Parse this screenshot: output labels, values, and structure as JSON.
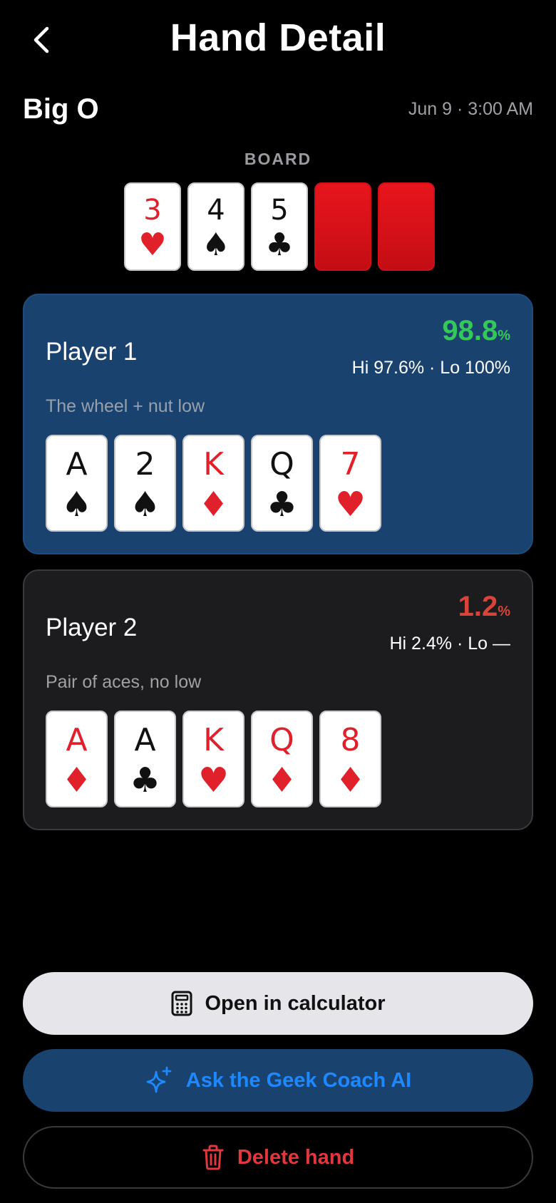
{
  "header": {
    "title": "Hand Detail",
    "back_icon": "chevron-left-icon"
  },
  "hand_info": {
    "game": "Big O",
    "datetime": "Jun 9 · 3:00 AM"
  },
  "board": {
    "label": "BOARD",
    "cards": [
      {
        "rank": "3",
        "suit": "♥",
        "color": "red"
      },
      {
        "rank": "4",
        "suit": "♠",
        "color": "black"
      },
      {
        "rank": "5",
        "suit": "♣",
        "color": "black"
      },
      {
        "face_down": true
      },
      {
        "face_down": true
      }
    ]
  },
  "players": [
    {
      "name": "Player 1",
      "equity": "98.8",
      "equity_unit": "%",
      "hilo": "Hi 97.6% · Lo 100%",
      "description": "The wheel + nut low",
      "accent": "#35c759",
      "cards": [
        {
          "rank": "A",
          "suit": "♠",
          "color": "black"
        },
        {
          "rank": "2",
          "suit": "♠",
          "color": "black"
        },
        {
          "rank": "K",
          "suit": "♦",
          "color": "red"
        },
        {
          "rank": "Q",
          "suit": "♣",
          "color": "black"
        },
        {
          "rank": "7",
          "suit": "♥",
          "color": "red"
        }
      ]
    },
    {
      "name": "Player 2",
      "equity": "1.2",
      "equity_unit": "%",
      "hilo": "Hi 2.4% · Lo —",
      "description": "Pair of aces, no low",
      "accent": "#d8433a",
      "cards": [
        {
          "rank": "A",
          "suit": "♦",
          "color": "red"
        },
        {
          "rank": "A",
          "suit": "♣",
          "color": "black"
        },
        {
          "rank": "K",
          "suit": "♥",
          "color": "red"
        },
        {
          "rank": "Q",
          "suit": "♦",
          "color": "red"
        },
        {
          "rank": "8",
          "suit": "♦",
          "color": "red"
        }
      ]
    }
  ],
  "actions": {
    "calculator_label": "Open in calculator",
    "calculator_icon": "calculator-icon",
    "coach_label": "Ask the Geek Coach AI",
    "coach_icon": "sparkles-icon",
    "delete_label": "Delete hand",
    "delete_icon": "trash-icon"
  },
  "colors": {
    "background": "#000000",
    "player1_card": "#19426f",
    "player2_card": "#1c1c1e",
    "link_blue": "#1e88ff",
    "destructive_red": "#e0383e",
    "card_red": "#e0202a"
  }
}
